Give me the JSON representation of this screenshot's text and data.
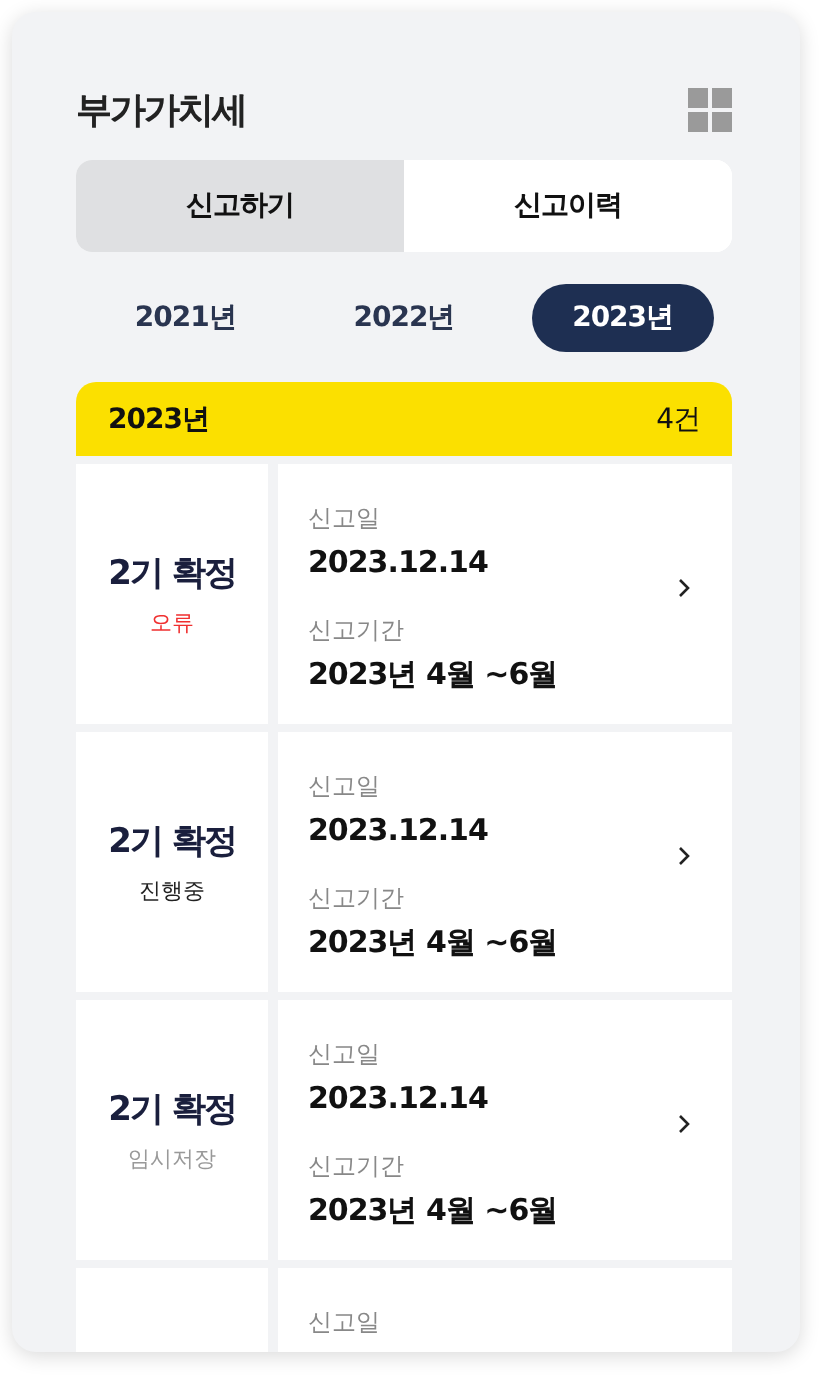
{
  "title": "부가가치세",
  "tabs": [
    {
      "label": "신고하기",
      "selected": false
    },
    {
      "label": "신고이력",
      "selected": true
    }
  ],
  "years": [
    {
      "label": "2021년",
      "selected": false
    },
    {
      "label": "2022년",
      "selected": false
    },
    {
      "label": "2023년",
      "selected": true
    }
  ],
  "summary": {
    "year": "2023년",
    "count": "4건"
  },
  "records": [
    {
      "title": "2기 확정",
      "status": "오류",
      "kind": "error",
      "date_label": "신고일",
      "date": "2023.12.14",
      "period_label": "신고기간",
      "period": "2023년 4월 ~6월"
    },
    {
      "title": "2기 확정",
      "status": "진행중",
      "kind": "progress",
      "date_label": "신고일",
      "date": "2023.12.14",
      "period_label": "신고기간",
      "period": "2023년 4월 ~6월"
    },
    {
      "title": "2기 확정",
      "status": "임시저장",
      "kind": "draft",
      "date_label": "신고일",
      "date": "2023.12.14",
      "period_label": "신고기간",
      "period": "2023년 4월 ~6월"
    },
    {
      "date_label": "신고일"
    }
  ]
}
